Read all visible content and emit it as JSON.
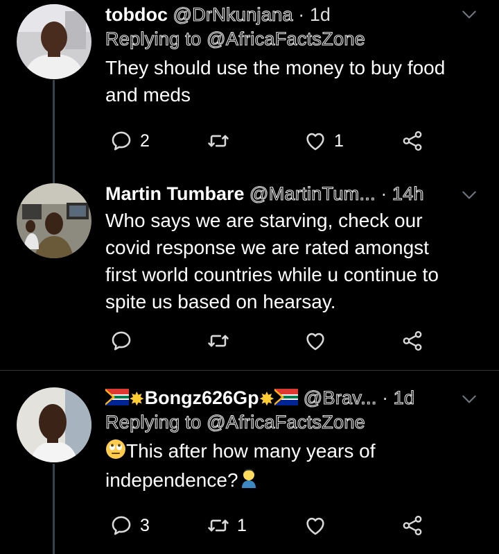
{
  "tweets": [
    {
      "name": "tobdoc",
      "handle": "@DrNkunjana",
      "time": "1d",
      "replying_to": "Replying to @AfricaFactsZone",
      "text_lines": [
        "They should use the money to buy food",
        "and meds"
      ],
      "replies": "2",
      "retweets": "",
      "likes": "1"
    },
    {
      "name": "Martin Tumbare",
      "handle": "@MartinTum...",
      "time": "14h",
      "text_lines": [
        "Who says we are starving, check our",
        "covid response we are rated amongst",
        "first world countries while u continue to",
        "spite us based on hearsay."
      ],
      "replies": "",
      "retweets": "",
      "likes": ""
    },
    {
      "name": "Bongz626Gp",
      "handle": "@Brav...",
      "time": "1d",
      "replying_to": "Replying to @AfricaFactsZone",
      "text_lines": [
        "This after how many years of",
        "independence?"
      ],
      "replies": "3",
      "retweets": "1",
      "likes": ""
    }
  ],
  "separator": "·",
  "icons": [
    "reply-icon",
    "retweet-icon",
    "like-icon",
    "share-icon",
    "chevron-down-icon"
  ],
  "colors": {
    "background": "#000000",
    "icon": "#d9d9d9",
    "divider": "#2f3336",
    "thread_line": "#38444d"
  }
}
